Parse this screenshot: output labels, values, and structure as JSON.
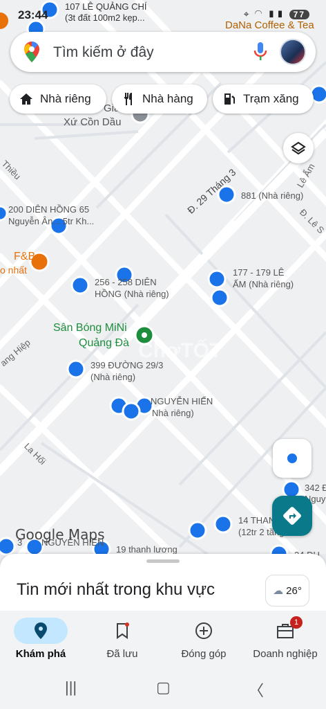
{
  "status_bar": {
    "time": "23:44",
    "battery": "77"
  },
  "search": {
    "placeholder": "Tìm kiếm ở đây"
  },
  "chips": [
    {
      "label": "Nhà riêng",
      "icon": "home-icon"
    },
    {
      "label": "Nhà hàng",
      "icon": "restaurant-icon"
    },
    {
      "label": "Trạm xăng",
      "icon": "gas-station-icon"
    }
  ],
  "map_labels": {
    "top_place": "107 LÊ QUẢNG CHÍ",
    "top_place_sub": "(3t đất 100m2 kẹp...",
    "coffee": "DaNa Coffee & Tea",
    "giao_xu_1": "Giá",
    "giao_xu_2": "Xứ Cồn Dầu",
    "thieu": "Thiều",
    "le_am_road": "Lê Ấm",
    "le_road": "Đ. Lê S",
    "road_293": "Đ. 29 Tháng 3",
    "p881": "881 (Nhà riêng)",
    "p200_1": "200 DIÊN HỒNG 65",
    "p200_2": "Nguyễn Ân... 5tr Kh...",
    "fb_1": "F&B",
    "fb_2": "o nhất",
    "p177_1": "177 - 179 LÊ",
    "p177_2": "ẤM (Nhà riêng)",
    "p256_1": "256 - 258 DIÊN",
    "p256_2": "HỒNG (Nhà riêng)",
    "san_bong_1": "Sân Bóng MiNi",
    "san_bong_2": "Quảng Đà",
    "ang_hiep": "ang Hiệp",
    "p399_1": "399 ĐƯỜNG 29/3",
    "p399_2": "(Nhà riêng)",
    "nguyen_hien_1": "NGUYỄN HIẾN",
    "nguyen_hien_2": "Nhà riêng)",
    "la_hoi": "La Hối",
    "p342_1": "342 Đ",
    "p342_2": "Nguye",
    "p14_1": "14 THAN",
    "p14_2": "(12tr 2 tầng",
    "nguyen_hien_bottom": "NGUYỄN HIẾN",
    "thanh_luong": "19 thanh lương",
    "p24": "24 ĐU",
    "p3_prefix": "3"
  },
  "watermark": "ChợTỐT",
  "logo_text": "Google Maps",
  "sheet": {
    "heading": "Tin mới nhất trong khu vực",
    "temperature": "26°"
  },
  "nav": [
    {
      "label": "Khám phá",
      "icon": "explore-pin-icon",
      "active": true
    },
    {
      "label": "Đã lưu",
      "icon": "bookmark-icon",
      "active": false
    },
    {
      "label": "Đóng góp",
      "icon": "add-circle-icon",
      "active": false
    },
    {
      "label": "Doanh nghiệp",
      "icon": "business-icon",
      "active": false,
      "badge": "1"
    }
  ],
  "colors": {
    "accent_teal": "#0a7a8a",
    "pin_blue": "#1a73e8",
    "poi_green": "#1e8e3e",
    "poi_orange": "#e8710a",
    "active_nav": "#c2e7ff"
  }
}
